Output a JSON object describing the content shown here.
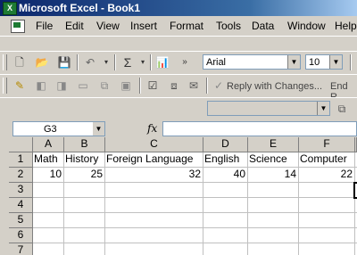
{
  "window": {
    "title": "Microsoft Excel - Book1"
  },
  "menu": [
    "File",
    "Edit",
    "View",
    "Insert",
    "Format",
    "Tools",
    "Data",
    "Window",
    "Help"
  ],
  "formatting": {
    "font": "Arial",
    "size": "10"
  },
  "reviewing": {
    "reply_label": "Reply with Changes...",
    "end_label": "End R"
  },
  "formula_bar": {
    "cell_ref": "G3",
    "fx_label": "fx",
    "formula": ""
  },
  "sheet": {
    "columns": [
      "A",
      "B",
      "C",
      "D",
      "E",
      "F"
    ],
    "rows": [
      "1",
      "2",
      "3",
      "4",
      "5",
      "6",
      "7"
    ],
    "row1": [
      "Math",
      "History",
      "Foreign Language",
      "English",
      "Science",
      "Computer"
    ],
    "row2": [
      "10",
      "25",
      "32",
      "40",
      "14",
      "22"
    ],
    "selected_cell": "G3"
  }
}
